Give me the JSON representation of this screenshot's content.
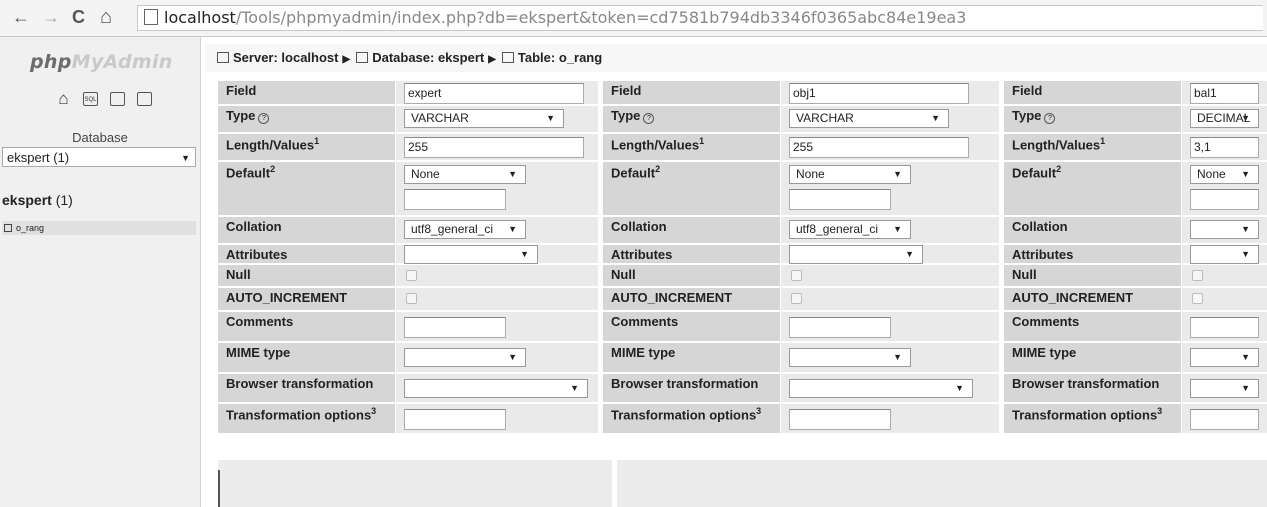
{
  "browser": {
    "back": "←",
    "forward": "→",
    "reload": "C",
    "home": "⌂",
    "url_host": "localhost",
    "url_path": "/Tools/phpmyadmin/index.php?db=ekspert&token=cd7581b794db3346f0365abc84e19ea3"
  },
  "sidebar": {
    "logo_php": "php",
    "logo_myadmin": "MyAdmin",
    "quick_icons": [
      "home-icon",
      "sql-icon",
      "query-window-icon",
      "docs-icon"
    ],
    "sql_label": "SQL",
    "database_label": "Database",
    "database_select": "ekspert (1)",
    "db_name": "ekspert",
    "db_count": "(1)",
    "table_item": "o_rang"
  },
  "breadcrumb": {
    "server": "Server: localhost",
    "database": "Database: ekspert",
    "table": "Table: o_rang",
    "sep": "▶"
  },
  "labels": {
    "field": "Field",
    "type": "Type",
    "length": "Length/Values",
    "length_sup": "1",
    "default": "Default",
    "default_sup": "2",
    "collation": "Collation",
    "attributes": "Attributes",
    "null": "Null",
    "auto_increment": "AUTO_INCREMENT",
    "comments": "Comments",
    "mime": "MIME type",
    "browser_transformation": "Browser transformation",
    "transformation_options": "Transformation options",
    "transformation_sup": "3"
  },
  "columns": [
    {
      "field": "expert",
      "type": "VARCHAR",
      "length": "255",
      "default": "None",
      "collation": "utf8_general_ci",
      "attributes": "",
      "mime": "",
      "browser_transformation": ""
    },
    {
      "field": "obj1",
      "type": "VARCHAR",
      "length": "255",
      "default": "None",
      "collation": "utf8_general_ci",
      "attributes": "",
      "mime": "",
      "browser_transformation": ""
    },
    {
      "field": "bal1",
      "type": "DECIMAL",
      "length": "3,1",
      "default": "None",
      "collation": "",
      "attributes": "",
      "mime": "",
      "browser_transformation": ""
    }
  ]
}
